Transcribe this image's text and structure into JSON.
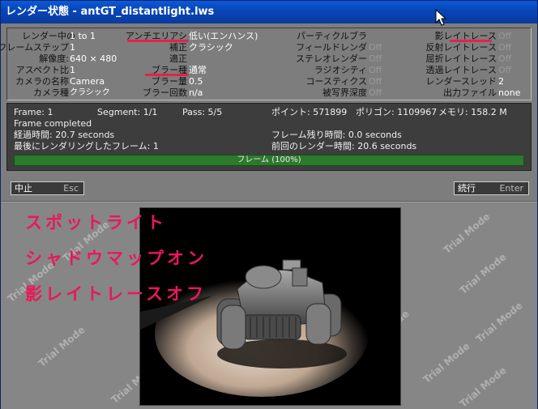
{
  "window": {
    "title": "レンダー状態 - antGT_distantlight.lws"
  },
  "settings": {
    "render_frame_label": "レンダー中の",
    "render_frame_value": "1 to 1",
    "frame_step_label": "フレームステップ",
    "frame_step_value": "1",
    "resolution_label": "解像度:",
    "resolution_value": "640 × 480",
    "aspect_label": "アスペクト比",
    "aspect_value": "1",
    "camera_name_label": "カメラの名称",
    "camera_name_value": "Camera",
    "camera_type_label": "カメラ種",
    "camera_type_value": "クラシック",
    "antialias_label": "アンチエリアシ",
    "antialias_value": "低い(エンハンス)",
    "reconstruction_label": "補正",
    "reconstruction_value": "クラシック",
    "adaptive_label": "適正",
    "adaptive_value": "",
    "blur_type_label": "ブラー種",
    "blur_type_value": "通常",
    "blur_amount_label": "ブラー量",
    "blur_amount_value": "0.5",
    "blur_passes_label": "ブラー回数",
    "blur_passes_value": "n/a",
    "particle_blur_label": "パーティクルブラ",
    "particle_blur_value": "",
    "field_render_label": "フィールドレンダ",
    "field_render_value": "Off",
    "stereo_label": "ステレオレンダー",
    "stereo_value": "Off",
    "radiosity_label": "ラジオシティ",
    "radiosity_value": "Off",
    "caustics_label": "コースティクス",
    "caustics_value": "Off",
    "dof_label": "被写界深度",
    "dof_value": "Off",
    "shadow_rt_label": "影レイトレース",
    "shadow_rt_value": "Off",
    "reflect_rt_label": "反射レイトレース",
    "reflect_rt_value": "Off",
    "refract_rt_label": "屈折レイトレース",
    "refract_rt_value": "Off",
    "trans_rt_label": "透過レイトレース",
    "trans_rt_value": "Off",
    "threads_label": "レンダースレッド",
    "threads_value": "2",
    "output_label": "出力ファイル",
    "output_value": "none"
  },
  "status": {
    "frame": "Frame: 1",
    "segment": "Segment: 1/1",
    "pass": "Pass: 5/5",
    "points": "ポイント: 571899",
    "polygons": "ポリゴン: 1109967",
    "memory": "メモリ: 158.2 M",
    "message": "Frame completed",
    "elapsed": "経過時間: 20.7 seconds",
    "remaining": "フレーム残り時間: 0.0 seconds",
    "last_frame": "最後にレンダリングしたフレーム: 1",
    "last_time": "前回のレンダー時間: 20.6 seconds",
    "progress_label": "フレーム (100%)",
    "progress_value": 100
  },
  "buttons": {
    "abort_label": "中止",
    "abort_shortcut": "Esc",
    "continue_label": "続行",
    "continue_shortcut": "Enter"
  },
  "annotations": [
    "スポットライト",
    "シャドウマップオン",
    "影レイトレースオフ"
  ],
  "watermark_text": "Trial Mode",
  "colors": {
    "title_bar": "#0846b8",
    "annotation": "#e8185a",
    "progress": "#2c7a2c"
  }
}
